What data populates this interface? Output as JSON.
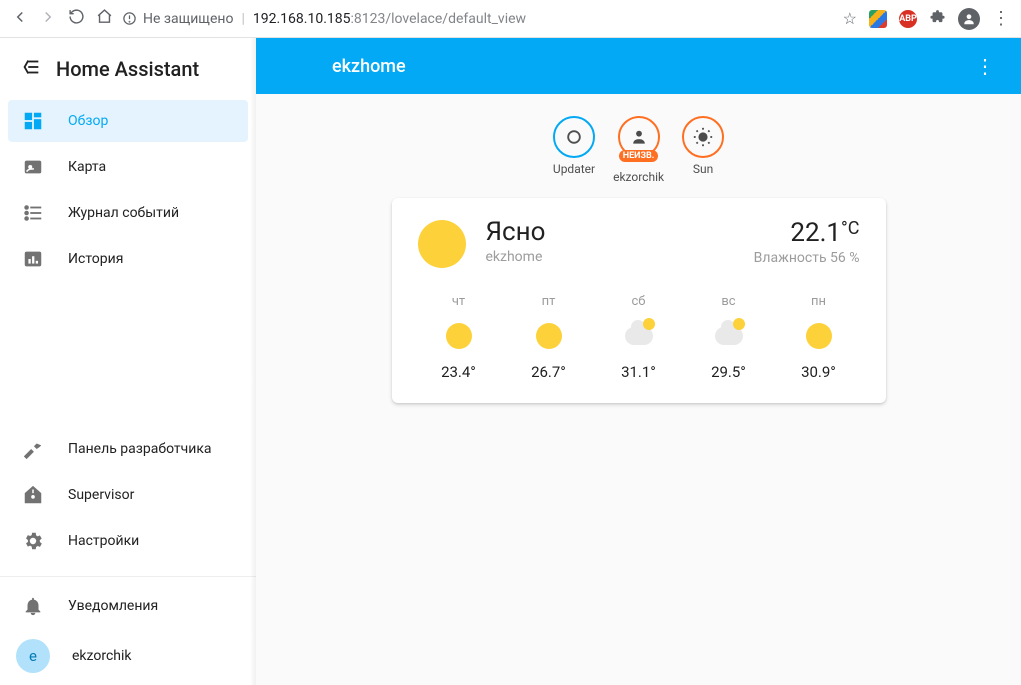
{
  "browser": {
    "insecure_label": "Не защищено",
    "url_host": "192.168.10.185",
    "url_port": ":8123",
    "url_path": "/lovelace/default_view",
    "abp": "ABP"
  },
  "sidebar": {
    "title": "Home Assistant",
    "items": [
      {
        "label": "Обзор"
      },
      {
        "label": "Карта"
      },
      {
        "label": "Журнал событий"
      },
      {
        "label": "История"
      }
    ],
    "items2": [
      {
        "label": "Панель разработчика"
      },
      {
        "label": "Supervisor"
      },
      {
        "label": "Настройки"
      }
    ],
    "notifications": "Уведомления",
    "user": {
      "initial": "e",
      "name": "ekzorchik"
    }
  },
  "topbar": {
    "title": "ekzhome"
  },
  "badges": [
    {
      "label": "Updater",
      "style": "blue",
      "icon": "ring"
    },
    {
      "label": "ekzorchik",
      "style": "orange",
      "icon": "person",
      "tag": "НЕИЗВ."
    },
    {
      "label": "Sun",
      "style": "orange",
      "icon": "sun"
    }
  ],
  "weather": {
    "condition": "Ясно",
    "location": "ekzhome",
    "temp_value": "22.1",
    "temp_unit": "°C",
    "humidity_label": "Влажность 56 %",
    "forecast": [
      {
        "dow": "чт",
        "icon": "sun",
        "temp": "23.4°"
      },
      {
        "dow": "пт",
        "icon": "sun",
        "temp": "26.7°"
      },
      {
        "dow": "сб",
        "icon": "cloud",
        "temp": "31.1°"
      },
      {
        "dow": "вс",
        "icon": "cloud",
        "temp": "29.5°"
      },
      {
        "dow": "пн",
        "icon": "sun",
        "temp": "30.9°"
      }
    ]
  }
}
